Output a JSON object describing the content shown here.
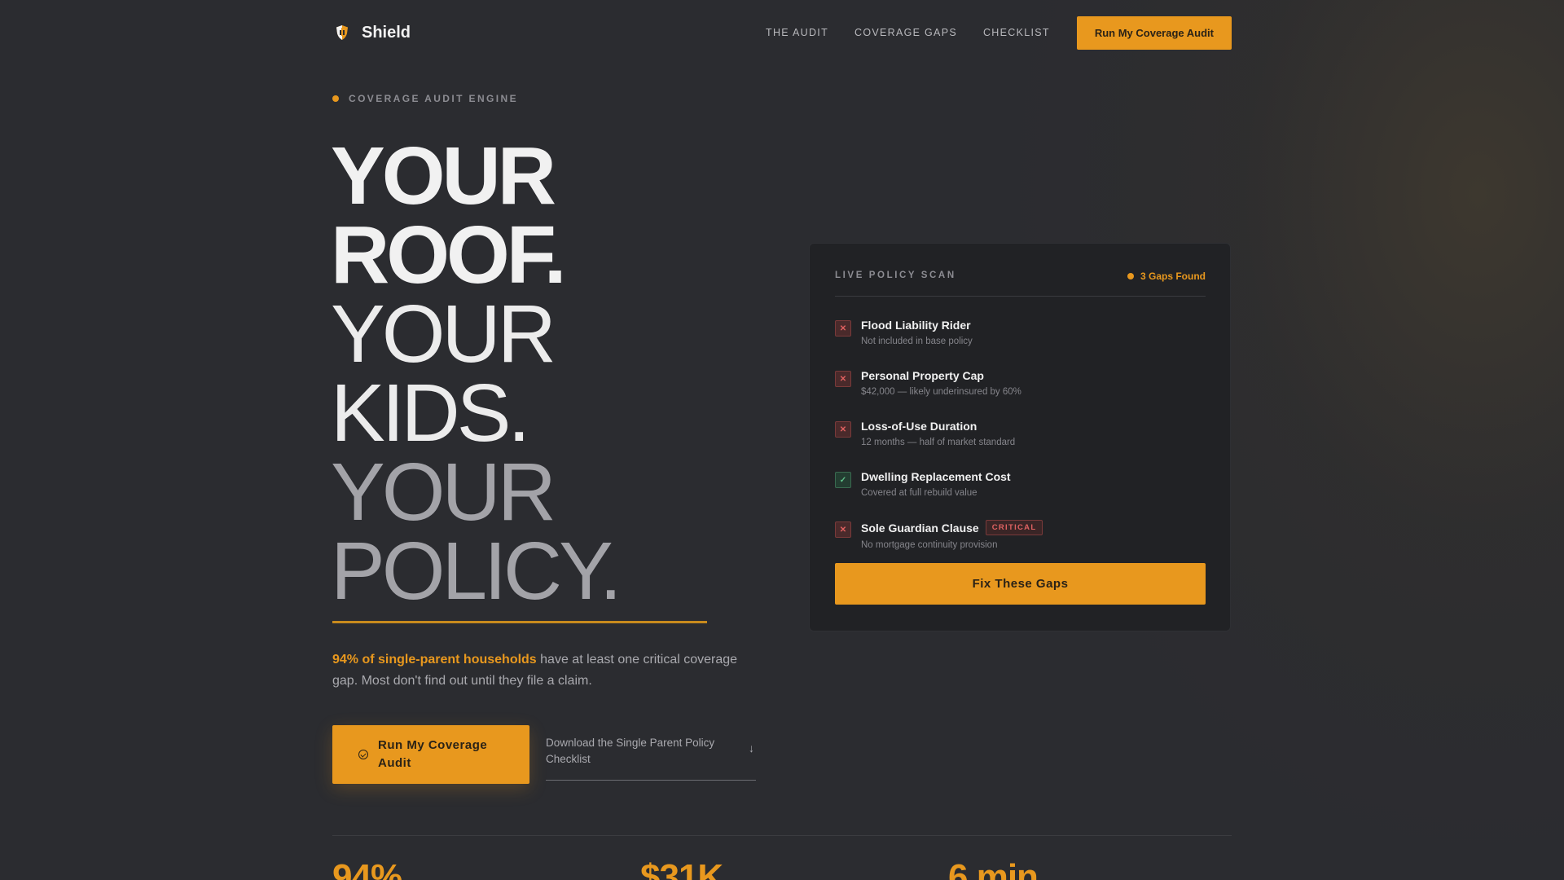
{
  "nav": {
    "brand": "Shield",
    "links": [
      "THE AUDIT",
      "COVERAGE GAPS",
      "CHECKLIST"
    ],
    "cta": "Run My Coverage Audit"
  },
  "hero": {
    "eyebrow": "COVERAGE AUDIT ENGINE",
    "headline_lines": [
      "YOUR",
      "ROOF.",
      "YOUR",
      "KIDS.",
      "YOUR",
      "POLICY."
    ],
    "lead_highlight": "94% of single-parent households",
    "lead_rest": " have at least one critical coverage gap. Most don't find out until they file a claim.",
    "cta": "Run My Coverage Audit",
    "download_link": "Download the Single Parent Policy Checklist",
    "download_arrow": "↓"
  },
  "scan": {
    "title": "LIVE POLICY SCAN",
    "gaps_badge": "3 Gaps Found",
    "items": [
      {
        "name": "Flood Liability Rider",
        "desc": "Not included in base policy",
        "status": "✕"
      },
      {
        "name": "Personal Property Cap",
        "desc": "$42,000 — likely underinsured by 60%",
        "status": "✕"
      },
      {
        "name": "Loss-of-Use Duration",
        "desc": "12 months — half of market standard",
        "status": "✕"
      },
      {
        "name": "Dwelling Replacement Cost",
        "desc": "Covered at full rebuild value",
        "status": "✓"
      },
      {
        "name": "Sole Guardian Clause",
        "desc": "No mortgage continuity provision",
        "status": "✕",
        "tag": "CRITICAL"
      }
    ],
    "cta": "Fix These Gaps"
  },
  "stats": [
    "94%",
    "$31K",
    "6 min"
  ],
  "colors": {
    "accent": "#e8981e",
    "background": "#2b2c30",
    "card": "#212225",
    "danger": "#e06060",
    "success": "#5fc08a"
  }
}
